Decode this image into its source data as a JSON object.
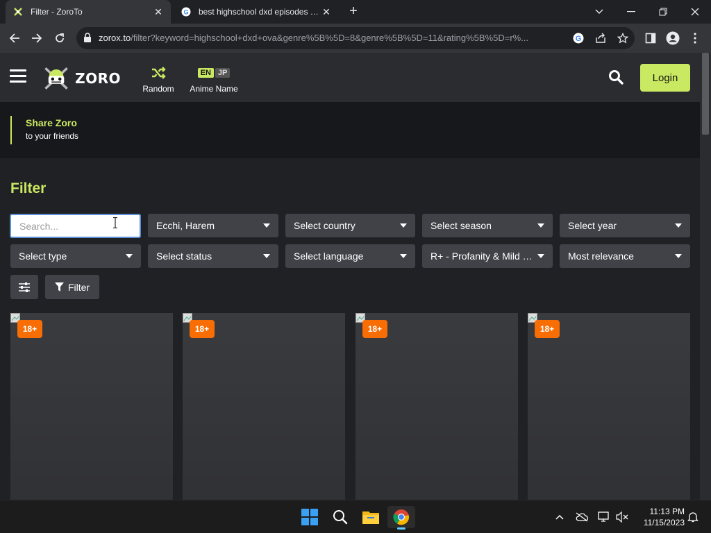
{
  "browser": {
    "tabs": [
      {
        "title": "Filter - ZoroTo",
        "active": true,
        "favicon": "zoro-favicon"
      },
      {
        "title": "best highschool dxd episodes - Google Search",
        "active": false,
        "favicon": "google-favicon"
      }
    ],
    "url_host": "zorox.to",
    "url_path": "/filter?keyword=highschool+dxd+ova&genre%5B%5D=8&genre%5B%5D=11&rating%5B%5D=r%..."
  },
  "site": {
    "logo_text": "ZORO",
    "random_label": "Random",
    "lang_en": "EN",
    "lang_jp": "JP",
    "anime_name_label": "Anime Name",
    "login_label": "Login",
    "accent": "#cae962"
  },
  "share": {
    "title": "Share Zoro",
    "subtitle": "to your friends"
  },
  "filter": {
    "heading": "Filter",
    "search_placeholder": "Search...",
    "genre": "Ecchi, Harem",
    "country": "Select country",
    "season": "Select season",
    "year": "Select year",
    "type": "Select type",
    "status": "Select status",
    "language": "Select language",
    "rating": "R+ - Profanity & Mild Nudity",
    "sort": "Most relevance",
    "filter_button": "Filter"
  },
  "results": [
    {
      "badge": "18+"
    },
    {
      "badge": "18+"
    },
    {
      "badge": "18+"
    },
    {
      "badge": "18+"
    }
  ],
  "taskbar": {
    "time": "11:13 PM",
    "date": "11/15/2023"
  }
}
